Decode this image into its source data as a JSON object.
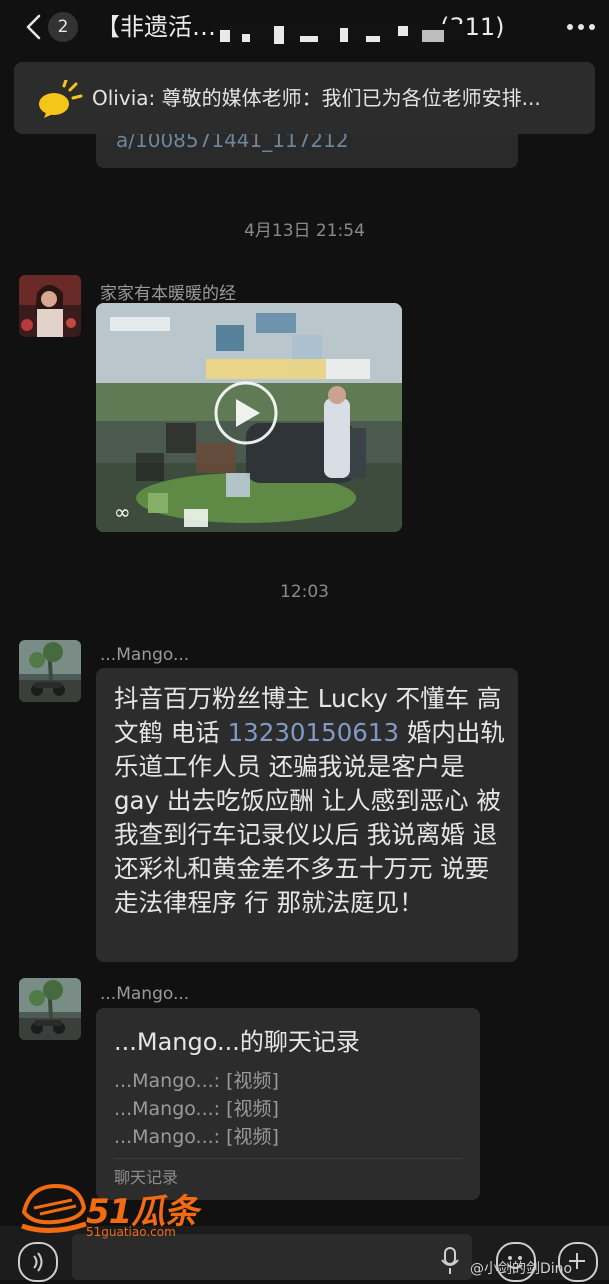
{
  "header": {
    "unread_count": "2",
    "title_left": "【非遗活…",
    "title_right": "…(311)"
  },
  "notice": {
    "text": "Olivia: 尊敬的媒体老师：我们已为各位老师安排..."
  },
  "prev_message": {
    "link_fragment": "a/1008571441_117212"
  },
  "messages": [
    {
      "timestamp": "4月13日 21:54",
      "sender": "家家有本暖暖的经",
      "type": "video"
    },
    {
      "timestamp": "12:03",
      "sender": "...Mango...",
      "type": "text",
      "text_before_phone": "抖音百万粉丝博主 Lucky 不懂车 高文鹤 电话 ",
      "phone": "13230150613",
      "text_after_phone": " 婚内出轨乐道工作人员 还骗我说是客户是gay 出去吃饭应酬 让人感到恶心 被我查到行车记录仪以后 我说离婚 退还彩礼和黄金差不多五十万元 说要走法律程序 行 那就法庭见！"
    },
    {
      "sender": "...Mango...",
      "type": "chat_record",
      "card_title": "...Mango...的聊天记录",
      "lines": [
        "...Mango...: [视频]",
        "...Mango...: [视频]",
        "...Mango...: [视频]"
      ],
      "footer": "聊天记录"
    }
  ],
  "watermark": {
    "brand": "51瓜条",
    "site": "51guatiao.com",
    "weibo": "@小剑的剑Dino"
  },
  "colors": {
    "background": "#111111",
    "bubble": "#2c2c2c",
    "link": "#7f9bc4",
    "watermark_orange": "#f26b13"
  },
  "icons": [
    "back-chevron-icon",
    "more-dots-icon",
    "megaphone-icon",
    "voice-icon",
    "mic-icon",
    "emoji-icon",
    "add-icon"
  ]
}
